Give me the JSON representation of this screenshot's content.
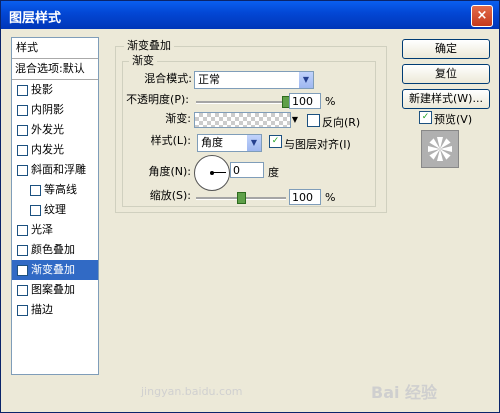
{
  "window": {
    "title": "图层样式",
    "close_label": "×"
  },
  "sidebar": {
    "header": "样式",
    "blend_item": "混合选项:默认",
    "items": [
      {
        "label": "投影",
        "checked": ""
      },
      {
        "label": "内阴影",
        "checked": ""
      },
      {
        "label": "外发光",
        "checked": ""
      },
      {
        "label": "内发光",
        "checked": ""
      },
      {
        "label": "斜面和浮雕",
        "checked": ""
      },
      {
        "label": "等高线",
        "checked": ""
      },
      {
        "label": "纹理",
        "checked": ""
      },
      {
        "label": "光泽",
        "checked": ""
      },
      {
        "label": "颜色叠加",
        "checked": ""
      },
      {
        "label": "渐变叠加",
        "checked": "✓"
      },
      {
        "label": "图案叠加",
        "checked": ""
      },
      {
        "label": "描边",
        "checked": ""
      }
    ]
  },
  "panel": {
    "outer_title": "渐变叠加",
    "inner_title": "渐变",
    "blend_mode_label": "混合模式:",
    "blend_mode_value": "正常",
    "opacity_label": "不透明度(P):",
    "opacity_value": "100",
    "gradient_label": "渐变:",
    "reverse_label": "反向(R)",
    "style_label": "样式(L):",
    "style_value": "角度",
    "align_label": "与图层对齐(I)",
    "align_checked": "✓",
    "angle_label": "角度(N):",
    "angle_value": "0",
    "angle_unit": "度",
    "scale_label": "缩放(S):",
    "scale_value": "100",
    "percent": "%",
    "opacity_level": 1.0,
    "scale_level": 0.5
  },
  "buttons": {
    "ok": "确定",
    "reset": "复位",
    "new_style": "新建样式(W)...",
    "preview_label": "预览(V)",
    "preview_checked": "✓"
  },
  "watermark": "jingyan.baidu.com",
  "baidu_logo": "Bai 经验"
}
